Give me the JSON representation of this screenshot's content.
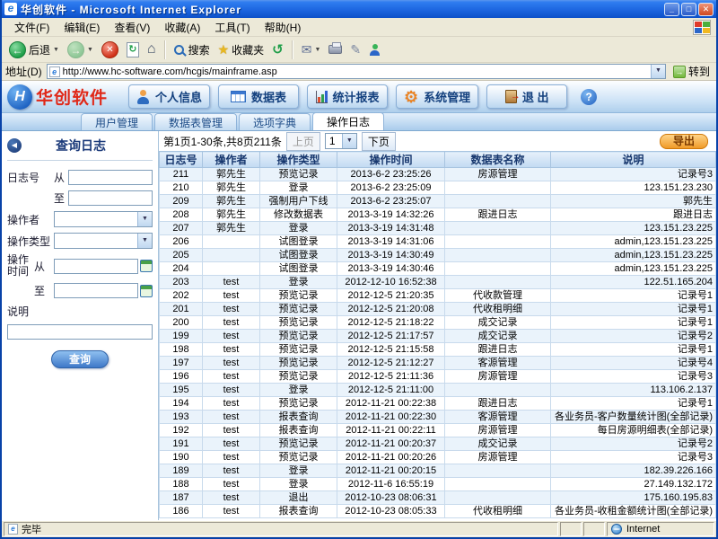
{
  "window": {
    "title": "华创软件 - Microsoft Internet Explorer"
  },
  "menu": {
    "items": [
      "文件(F)",
      "编辑(E)",
      "查看(V)",
      "收藏(A)",
      "工具(T)",
      "帮助(H)"
    ]
  },
  "toolbar": {
    "back_label": "后退",
    "search_label": "搜索",
    "favorites_label": "收藏夹"
  },
  "address": {
    "label": "地址(D)",
    "url": "http://www.hc-software.com/hcgis/mainframe.asp",
    "go_label": "转到"
  },
  "header": {
    "brand": "华创软件",
    "nav": [
      {
        "label": "个人信息",
        "icon": "user-icon"
      },
      {
        "label": "数据表",
        "icon": "table-icon"
      },
      {
        "label": "统计报表",
        "icon": "chart-icon"
      },
      {
        "label": "系统管理",
        "icon": "gear-icon"
      },
      {
        "label": "退 出",
        "icon": "exit-icon"
      }
    ]
  },
  "tabs": [
    {
      "label": "用户管理",
      "active": false
    },
    {
      "label": "数据表管理",
      "active": false
    },
    {
      "label": "选项字典",
      "active": false
    },
    {
      "label": "操作日志",
      "active": true
    }
  ],
  "sidebar": {
    "title": "查询日志",
    "log_no_label": "日志号",
    "from_label": "从",
    "to_label": "至",
    "operator_label": "操作者",
    "op_type_label": "操作类型",
    "op_time_label_1": "操作",
    "op_time_label_2": "时间",
    "desc_label": "说明",
    "search_button": "查询"
  },
  "pagination": {
    "info": "第1页1-30条,共8页211条",
    "prev": "上页",
    "page_value": "1",
    "next": "下页"
  },
  "export_button": "导出",
  "table": {
    "headers": [
      "日志号",
      "操作者",
      "操作类型",
      "操作时间",
      "数据表名称",
      "说明"
    ],
    "keys": [
      "log-no",
      "operator",
      "op-type",
      "op-time",
      "table-name",
      "description"
    ],
    "rows": [
      [
        "211",
        "郭先生",
        "预览记录",
        "2013-6-2 23:25:26",
        "房源管理",
        "记录号3"
      ],
      [
        "210",
        "郭先生",
        "登录",
        "2013-6-2 23:25:09",
        "",
        "123.151.23.230"
      ],
      [
        "209",
        "郭先生",
        "强制用户下线",
        "2013-6-2 23:25:07",
        "",
        "郭先生"
      ],
      [
        "208",
        "郭先生",
        "修改数据表",
        "2013-3-19 14:32:26",
        "跟进日志",
        "跟进日志"
      ],
      [
        "207",
        "郭先生",
        "登录",
        "2013-3-19 14:31:48",
        "",
        "123.151.23.225"
      ],
      [
        "206",
        "",
        "试图登录",
        "2013-3-19 14:31:06",
        "",
        "admin,123.151.23.225"
      ],
      [
        "205",
        "",
        "试图登录",
        "2013-3-19 14:30:49",
        "",
        "admin,123.151.23.225"
      ],
      [
        "204",
        "",
        "试图登录",
        "2013-3-19 14:30:46",
        "",
        "admin,123.151.23.225"
      ],
      [
        "203",
        "test",
        "登录",
        "2012-12-10 16:52:38",
        "",
        "122.51.165.204"
      ],
      [
        "202",
        "test",
        "预览记录",
        "2012-12-5 21:20:35",
        "代收款管理",
        "记录号1"
      ],
      [
        "201",
        "test",
        "预览记录",
        "2012-12-5 21:20:08",
        "代收租明细",
        "记录号1"
      ],
      [
        "200",
        "test",
        "预览记录",
        "2012-12-5 21:18:22",
        "成交记录",
        "记录号1"
      ],
      [
        "199",
        "test",
        "预览记录",
        "2012-12-5 21:17:57",
        "成交记录",
        "记录号2"
      ],
      [
        "198",
        "test",
        "预览记录",
        "2012-12-5 21:15:58",
        "跟进日志",
        "记录号1"
      ],
      [
        "197",
        "test",
        "预览记录",
        "2012-12-5 21:12:27",
        "客源管理",
        "记录号4"
      ],
      [
        "196",
        "test",
        "预览记录",
        "2012-12-5 21:11:36",
        "房源管理",
        "记录号3"
      ],
      [
        "195",
        "test",
        "登录",
        "2012-12-5 21:11:00",
        "",
        "113.106.2.137"
      ],
      [
        "194",
        "test",
        "预览记录",
        "2012-11-21 00:22:38",
        "跟进日志",
        "记录号1"
      ],
      [
        "193",
        "test",
        "报表查询",
        "2012-11-21 00:22:30",
        "客源管理",
        "各业务员-客户数量统计图(全部记录)"
      ],
      [
        "192",
        "test",
        "报表查询",
        "2012-11-21 00:22:11",
        "房源管理",
        "每日房源明细表(全部记录)"
      ],
      [
        "191",
        "test",
        "预览记录",
        "2012-11-21 00:20:37",
        "成交记录",
        "记录号2"
      ],
      [
        "190",
        "test",
        "预览记录",
        "2012-11-21 00:20:26",
        "房源管理",
        "记录号3"
      ],
      [
        "189",
        "test",
        "登录",
        "2012-11-21 00:20:15",
        "",
        "182.39.226.166"
      ],
      [
        "188",
        "test",
        "登录",
        "2012-11-6 16:55:19",
        "",
        "27.149.132.172"
      ],
      [
        "187",
        "test",
        "退出",
        "2012-10-23 08:06:31",
        "",
        "175.160.195.83"
      ],
      [
        "186",
        "test",
        "报表查询",
        "2012-10-23 08:05:33",
        "代收租明细",
        "各业务员-收租金额统计图(全部记录)"
      ]
    ]
  },
  "statusbar": {
    "status": "完毕",
    "zone": "Internet"
  },
  "icons": {
    "ie": "e",
    "minimize": "_",
    "maximize": "□",
    "close": "✕",
    "back_arrow": "←",
    "forward_arrow": "→",
    "stop": "✕",
    "refresh": "↻",
    "home": "⌂",
    "favorites_star": "★",
    "history": "↺",
    "mail": "✉",
    "edit": "✎",
    "gear": "⚙",
    "help": "?",
    "go_arrow": "→",
    "dropdown": "▼",
    "back_nav": "◀",
    "logo_h": "H"
  },
  "colors": {
    "titlebar_blue": "#1D66E0",
    "brand_red": "#E02818",
    "nav_text_blue": "#13407E",
    "export_orange": "#F09A28",
    "search_button_blue": "#3E78C8",
    "row_alt_blue": "#EAF3FB",
    "table_header_blue": "#C2DAF2",
    "gear_orange": "#F08018"
  }
}
